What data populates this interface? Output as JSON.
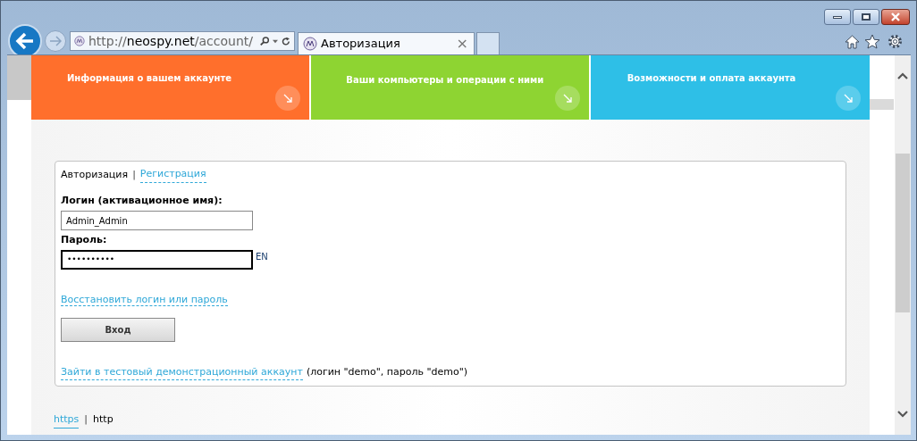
{
  "browser": {
    "address": {
      "prefix": "http://",
      "domain": "neospy.net",
      "path": "/account/"
    },
    "tab": {
      "title": "Авторизация",
      "close": "×",
      "selected": true
    }
  },
  "tiles": [
    {
      "label": "Информация о вашем аккаунте",
      "color": "#ff6f2c"
    },
    {
      "label": "Ваши компьютеры и операции с ними",
      "color": "#8ed432"
    },
    {
      "label": "Возможности и оплата аккаунта",
      "color": "#2ebfe7"
    }
  ],
  "form": {
    "tabs": [
      {
        "label": "Авторизация",
        "selected": true
      },
      {
        "label": "Регистрация",
        "selected": false
      }
    ],
    "separator": "|",
    "login": {
      "label": "Логин (активационное имя):",
      "value": "Admin_Admin"
    },
    "password": {
      "label": "Пароль:",
      "value": "••••••••••",
      "focused": true,
      "layout": "EN"
    },
    "recover_link": "Восстановить логин или пароль",
    "submit": "Вход",
    "demo_link": "Зайти в тестовый демонстрационный аккаунт",
    "demo_note": "(логин \"demo\", пароль \"demo\")"
  },
  "footer": [
    {
      "label": "https",
      "selected": false
    },
    {
      "label": "http",
      "selected": true
    }
  ],
  "footer_separator": "|"
}
